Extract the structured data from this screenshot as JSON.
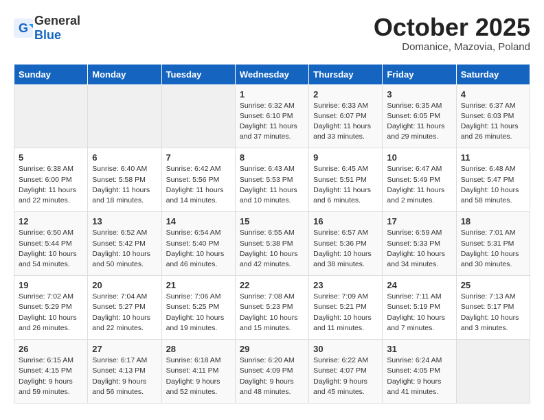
{
  "header": {
    "logo": {
      "general": "General",
      "blue": "Blue"
    },
    "title": "October 2025",
    "subtitle": "Domanice, Mazovia, Poland"
  },
  "weekdays": [
    "Sunday",
    "Monday",
    "Tuesday",
    "Wednesday",
    "Thursday",
    "Friday",
    "Saturday"
  ],
  "weeks": [
    [
      {
        "day": "",
        "empty": true
      },
      {
        "day": "",
        "empty": true
      },
      {
        "day": "",
        "empty": true
      },
      {
        "day": "1",
        "sunrise": "6:32 AM",
        "sunset": "6:10 PM",
        "daylight": "11 hours and 37 minutes."
      },
      {
        "day": "2",
        "sunrise": "6:33 AM",
        "sunset": "6:07 PM",
        "daylight": "11 hours and 33 minutes."
      },
      {
        "day": "3",
        "sunrise": "6:35 AM",
        "sunset": "6:05 PM",
        "daylight": "11 hours and 29 minutes."
      },
      {
        "day": "4",
        "sunrise": "6:37 AM",
        "sunset": "6:03 PM",
        "daylight": "11 hours and 26 minutes."
      }
    ],
    [
      {
        "day": "5",
        "sunrise": "6:38 AM",
        "sunset": "6:00 PM",
        "daylight": "11 hours and 22 minutes."
      },
      {
        "day": "6",
        "sunrise": "6:40 AM",
        "sunset": "5:58 PM",
        "daylight": "11 hours and 18 minutes."
      },
      {
        "day": "7",
        "sunrise": "6:42 AM",
        "sunset": "5:56 PM",
        "daylight": "11 hours and 14 minutes."
      },
      {
        "day": "8",
        "sunrise": "6:43 AM",
        "sunset": "5:53 PM",
        "daylight": "11 hours and 10 minutes."
      },
      {
        "day": "9",
        "sunrise": "6:45 AM",
        "sunset": "5:51 PM",
        "daylight": "11 hours and 6 minutes."
      },
      {
        "day": "10",
        "sunrise": "6:47 AM",
        "sunset": "5:49 PM",
        "daylight": "11 hours and 2 minutes."
      },
      {
        "day": "11",
        "sunrise": "6:48 AM",
        "sunset": "5:47 PM",
        "daylight": "10 hours and 58 minutes."
      }
    ],
    [
      {
        "day": "12",
        "sunrise": "6:50 AM",
        "sunset": "5:44 PM",
        "daylight": "10 hours and 54 minutes."
      },
      {
        "day": "13",
        "sunrise": "6:52 AM",
        "sunset": "5:42 PM",
        "daylight": "10 hours and 50 minutes."
      },
      {
        "day": "14",
        "sunrise": "6:54 AM",
        "sunset": "5:40 PM",
        "daylight": "10 hours and 46 minutes."
      },
      {
        "day": "15",
        "sunrise": "6:55 AM",
        "sunset": "5:38 PM",
        "daylight": "10 hours and 42 minutes."
      },
      {
        "day": "16",
        "sunrise": "6:57 AM",
        "sunset": "5:36 PM",
        "daylight": "10 hours and 38 minutes."
      },
      {
        "day": "17",
        "sunrise": "6:59 AM",
        "sunset": "5:33 PM",
        "daylight": "10 hours and 34 minutes."
      },
      {
        "day": "18",
        "sunrise": "7:01 AM",
        "sunset": "5:31 PM",
        "daylight": "10 hours and 30 minutes."
      }
    ],
    [
      {
        "day": "19",
        "sunrise": "7:02 AM",
        "sunset": "5:29 PM",
        "daylight": "10 hours and 26 minutes."
      },
      {
        "day": "20",
        "sunrise": "7:04 AM",
        "sunset": "5:27 PM",
        "daylight": "10 hours and 22 minutes."
      },
      {
        "day": "21",
        "sunrise": "7:06 AM",
        "sunset": "5:25 PM",
        "daylight": "10 hours and 19 minutes."
      },
      {
        "day": "22",
        "sunrise": "7:08 AM",
        "sunset": "5:23 PM",
        "daylight": "10 hours and 15 minutes."
      },
      {
        "day": "23",
        "sunrise": "7:09 AM",
        "sunset": "5:21 PM",
        "daylight": "10 hours and 11 minutes."
      },
      {
        "day": "24",
        "sunrise": "7:11 AM",
        "sunset": "5:19 PM",
        "daylight": "10 hours and 7 minutes."
      },
      {
        "day": "25",
        "sunrise": "7:13 AM",
        "sunset": "5:17 PM",
        "daylight": "10 hours and 3 minutes."
      }
    ],
    [
      {
        "day": "26",
        "sunrise": "6:15 AM",
        "sunset": "4:15 PM",
        "daylight": "9 hours and 59 minutes."
      },
      {
        "day": "27",
        "sunrise": "6:17 AM",
        "sunset": "4:13 PM",
        "daylight": "9 hours and 56 minutes."
      },
      {
        "day": "28",
        "sunrise": "6:18 AM",
        "sunset": "4:11 PM",
        "daylight": "9 hours and 52 minutes."
      },
      {
        "day": "29",
        "sunrise": "6:20 AM",
        "sunset": "4:09 PM",
        "daylight": "9 hours and 48 minutes."
      },
      {
        "day": "30",
        "sunrise": "6:22 AM",
        "sunset": "4:07 PM",
        "daylight": "9 hours and 45 minutes."
      },
      {
        "day": "31",
        "sunrise": "6:24 AM",
        "sunset": "4:05 PM",
        "daylight": "9 hours and 41 minutes."
      },
      {
        "day": "",
        "empty": true
      }
    ]
  ]
}
